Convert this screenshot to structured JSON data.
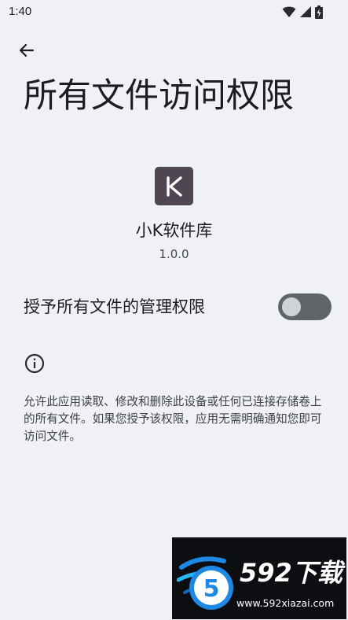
{
  "status_bar": {
    "time": "1:40",
    "icons": [
      "wifi-icon",
      "cellular-signal-icon",
      "battery-charging-icon"
    ]
  },
  "header": {
    "back_icon": "arrow-back-icon",
    "title": "所有文件访问权限"
  },
  "app": {
    "icon_letter": "K",
    "icon_color": "#4e4751",
    "name": "小K软件库",
    "version": "1.0.0"
  },
  "permission": {
    "label": "授予所有文件的管理权限",
    "enabled": false
  },
  "info": {
    "icon": "info-icon",
    "description": "允许此应用读取、修改和删除此设备或任何已连接存储卷上的所有文件。如果您授予该权限，应用无需明确通知您即可访问文件。"
  },
  "watermark": {
    "brand": "592下载",
    "url": "www.592xiazai.com"
  },
  "colors": {
    "background": "#eff1f4",
    "toggle_track": "#5f6466",
    "toggle_knob": "#d0d3d6",
    "text_primary": "#1c1d20",
    "text_secondary": "#43464b"
  }
}
